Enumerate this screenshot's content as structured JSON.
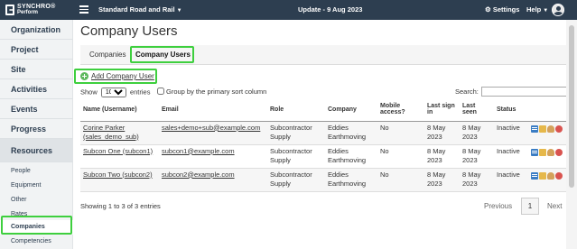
{
  "header": {
    "logo_line1": "SYNCHRO®",
    "logo_line2": "Perform",
    "tenant": "Standard Road and Rail",
    "update": "Update - 9 Aug 2023",
    "settings": "Settings",
    "help": "Help",
    "background": "#2d3e50"
  },
  "sidebar": {
    "items": [
      {
        "label": "Organization"
      },
      {
        "label": "Project"
      },
      {
        "label": "Site"
      },
      {
        "label": "Activities"
      },
      {
        "label": "Events"
      },
      {
        "label": "Progress"
      },
      {
        "label": "Resources"
      }
    ],
    "sub_items": [
      {
        "label": "People"
      },
      {
        "label": "Equipment"
      },
      {
        "label": "Other"
      },
      {
        "label": "Rates"
      },
      {
        "label": "Companies"
      },
      {
        "label": "Competencies"
      }
    ]
  },
  "main": {
    "title": "Company Users",
    "tabs": [
      {
        "label": "Companies"
      },
      {
        "label": "Company Users"
      }
    ],
    "add_user": "Add Company User",
    "show_label": "Show",
    "entries_label": "entries",
    "page_size": "100",
    "group_label": "Group by the primary sort column",
    "search_label": "Search:",
    "search_value": "",
    "columns": [
      "Name (Username)",
      "Email",
      "Role",
      "Company",
      "Mobile access?",
      "Last sign in",
      "Last seen",
      "Status",
      ""
    ],
    "rows": [
      {
        "name": "Corine Parker (sales_demo_sub)",
        "email": "sales+demo+sub@example.com",
        "role": "Subcontractor Supply",
        "company": "Eddies Earthmoving",
        "mobile": "No",
        "last_sign_in": "8 May 2023",
        "last_seen": "8 May 2023",
        "status": "Inactive"
      },
      {
        "name": "Subcon One (subcon1)",
        "email": "subcon1@example.com",
        "role": "Subcontractor Supply",
        "company": "Eddies Earthmoving",
        "mobile": "No",
        "last_sign_in": "8 May 2023",
        "last_seen": "8 May 2023",
        "status": "Inactive"
      },
      {
        "name": "Subcon Two (subcon2)",
        "email": "subcon2@example.com",
        "role": "Subcontractor Supply",
        "company": "Eddies Earthmoving",
        "mobile": "No",
        "last_sign_in": "8 May 2023",
        "last_seen": "8 May 2023",
        "status": "Inactive"
      }
    ],
    "footer_info": "Showing 1 to 3 of 3 entries",
    "pagination": {
      "previous": "Previous",
      "current": "1",
      "next": "Next"
    },
    "highlight_color": "#3ecf3e",
    "accent_green": "#5cb85c"
  }
}
